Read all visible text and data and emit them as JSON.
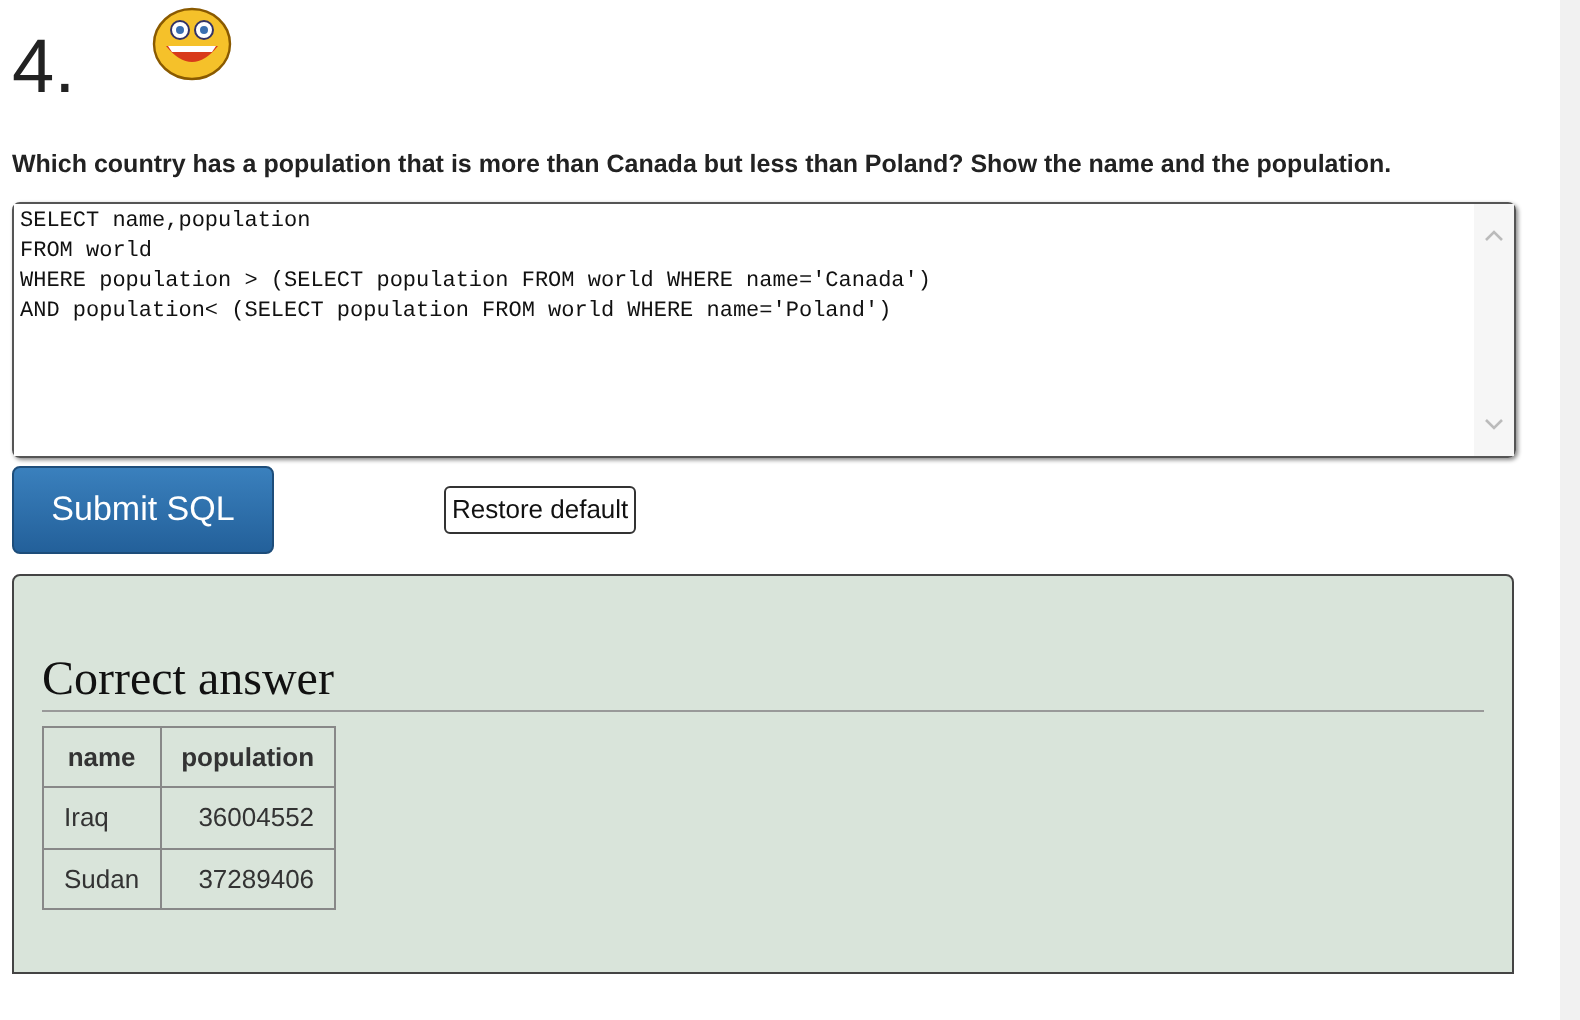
{
  "question": {
    "number": "4.",
    "text": "Which country has a population that is more than Canada but less than Poland? Show the name and the population."
  },
  "editor": {
    "value": "SELECT name,population\nFROM world\nWHERE population > (SELECT population FROM world WHERE name='Canada')\nAND population< (SELECT population FROM world WHERE name='Poland')"
  },
  "buttons": [
    {
      "kind": "submit",
      "label": "Submit SQL"
    },
    {
      "kind": "restore",
      "label": "Restore default"
    }
  ],
  "answer": {
    "title": "Correct answer",
    "table": {
      "columns": [
        "name",
        "population"
      ],
      "rows": [
        [
          "Iraq",
          "36004552"
        ],
        [
          "Sudan",
          "37289406"
        ]
      ]
    }
  }
}
